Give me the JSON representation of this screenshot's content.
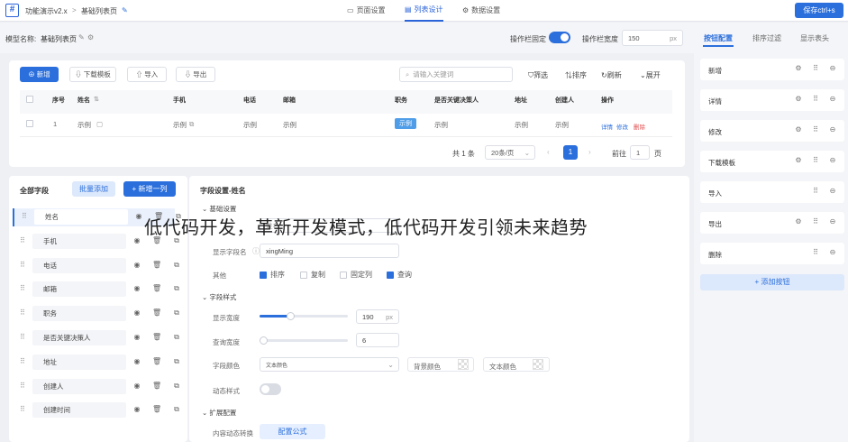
{
  "topbar": {
    "logo": "#",
    "crumb_app": "功能演示v2.x",
    "crumb_sep": ">",
    "crumb_page": "基础列表页",
    "tabs": [
      "页面设置",
      "列表设计",
      "数据设置"
    ],
    "save_label": "保存ctrl+s"
  },
  "model": {
    "label": "模型名称:",
    "name": "基础列表页",
    "header_fixed_label": "操作栏固定",
    "header_fixed_on": true,
    "column_width_label": "操作栏宽度",
    "column_width_value": "150",
    "column_width_unit": "px"
  },
  "toolbar": {
    "add": "新增",
    "download_template": "下载模板",
    "import": "导入",
    "export": "导出",
    "search_placeholder": "请输入关键词",
    "filter": "筛选",
    "sort": "排序",
    "refresh": "刷新",
    "expand": "展开"
  },
  "table": {
    "headers": [
      "序号",
      "姓名",
      "手机",
      "电话",
      "邮箱",
      "职务",
      "是否关键决策人",
      "地址",
      "创建人",
      "操作"
    ],
    "row": [
      "1",
      "示例",
      "示例",
      "示例",
      "示例",
      "示例",
      "示例",
      "示例",
      "示例"
    ],
    "actions": [
      "详情",
      "修改",
      "删除"
    ]
  },
  "pagination": {
    "total": "共 1 条",
    "page_size": "20条/页",
    "current": "1",
    "goto_label": "前往",
    "goto_value": "1",
    "page_suffix": "页"
  },
  "fields_panel": {
    "title": "全部字段",
    "batch_add": "批量添加",
    "add_column": "+ 新增一列",
    "fields": [
      "姓名",
      "手机",
      "电话",
      "邮箱",
      "职务",
      "是否关键决策人",
      "地址",
      "创建人",
      "创建时间"
    ]
  },
  "field_settings": {
    "title": "字段设置-姓名",
    "basic_section": "基础设置",
    "name_placeholder": "姓名",
    "display_name_label": "显示字段名",
    "display_name_value": "xingMing",
    "other_label": "其他",
    "options": [
      {
        "label": "排序",
        "checked": true
      },
      {
        "label": "复制",
        "checked": false
      },
      {
        "label": "固定列",
        "checked": false
      },
      {
        "label": "查询",
        "checked": true
      }
    ],
    "style_section": "字段样式",
    "display_width_label": "显示宽度",
    "display_width_value": "190",
    "display_width_unit": "px",
    "display_width_fraction": 0.35,
    "query_width_label": "查询宽度",
    "query_width_value": "6",
    "query_width_fraction": 0.0,
    "font_color_label": "字段颜色",
    "font_color_value": "文本颜色",
    "bg_color_label": "背景颜色",
    "text_color_label": "文本颜色",
    "dynamic_style_label": "动态样式",
    "dynamic_style_on": false,
    "extend_section": "扩展配置",
    "content_convert_label": "内容动态转换",
    "config_formula": "配置公式"
  },
  "right_panel": {
    "tabs": [
      "按钮配置",
      "排序过滤",
      "显示表头"
    ],
    "buttons": [
      "新增",
      "详情",
      "修改",
      "下载模板",
      "导入",
      "导出",
      "删除"
    ],
    "add_button": "+ 添加按钮"
  },
  "overlay_text": "低代码开发，革新开发模式，低代码开发引领未来趋势",
  "colors": {
    "accent": "#2b6fdc",
    "background": "#eef0f4"
  }
}
